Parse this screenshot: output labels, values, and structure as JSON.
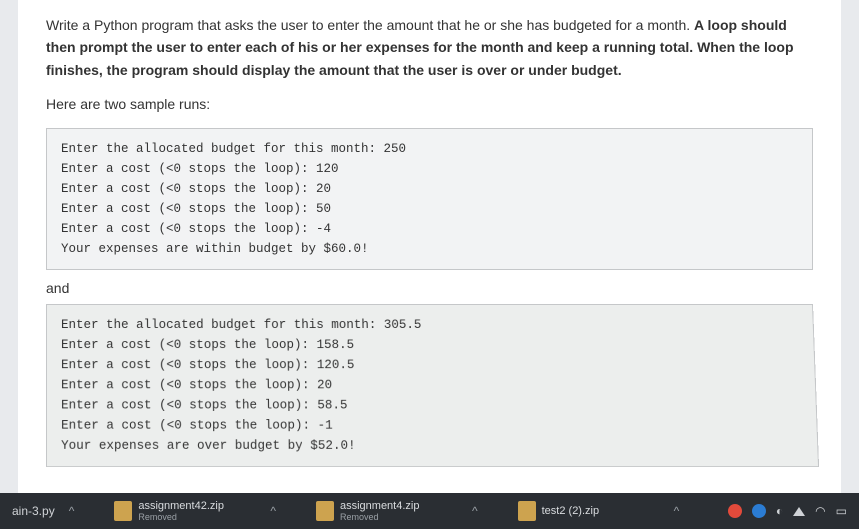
{
  "question": {
    "p1_a": "Write a Python program that asks the user to enter the amount that he or she has budgeted for a month. ",
    "p1_b": "A loop should then prompt the user to enter each of his or her expenses for the month and keep a running total. When the loop finishes, the program should display the amount that the user is over or under budget.",
    "p2": "Here are two sample runs:"
  },
  "sample1": {
    "l1": "Enter the allocated budget for this month: 250",
    "l2": "Enter a cost (<0 stops the loop): 120",
    "l3": "Enter a cost (<0 stops the loop): 20",
    "l4": "Enter a cost (<0 stops the loop): 50",
    "l5": "Enter a cost (<0 stops the loop): -4",
    "l6": "Your expenses are within budget by $60.0!"
  },
  "mid": "and",
  "sample2": {
    "l1": "Enter the allocated budget for this month: 305.5",
    "l2": "Enter a cost (<0 stops the loop): 158.5",
    "l3": "Enter a cost (<0 stops the loop): 120.5",
    "l4": "Enter a cost (<0 stops the loop): 20",
    "l5": "Enter a cost (<0 stops the loop): 58.5",
    "l6": "Enter a cost (<0 stops the loop): -1",
    "l7": "Your expenses are over budget by $52.0!"
  },
  "taskbar": {
    "left_file": "ain-3.py",
    "dl1": {
      "name": "assignment42.zip",
      "status": "Removed"
    },
    "dl2": {
      "name": "assignment4.zip",
      "status": "Removed"
    },
    "dl3": {
      "name": "test2 (2).zip",
      "status": ""
    }
  }
}
